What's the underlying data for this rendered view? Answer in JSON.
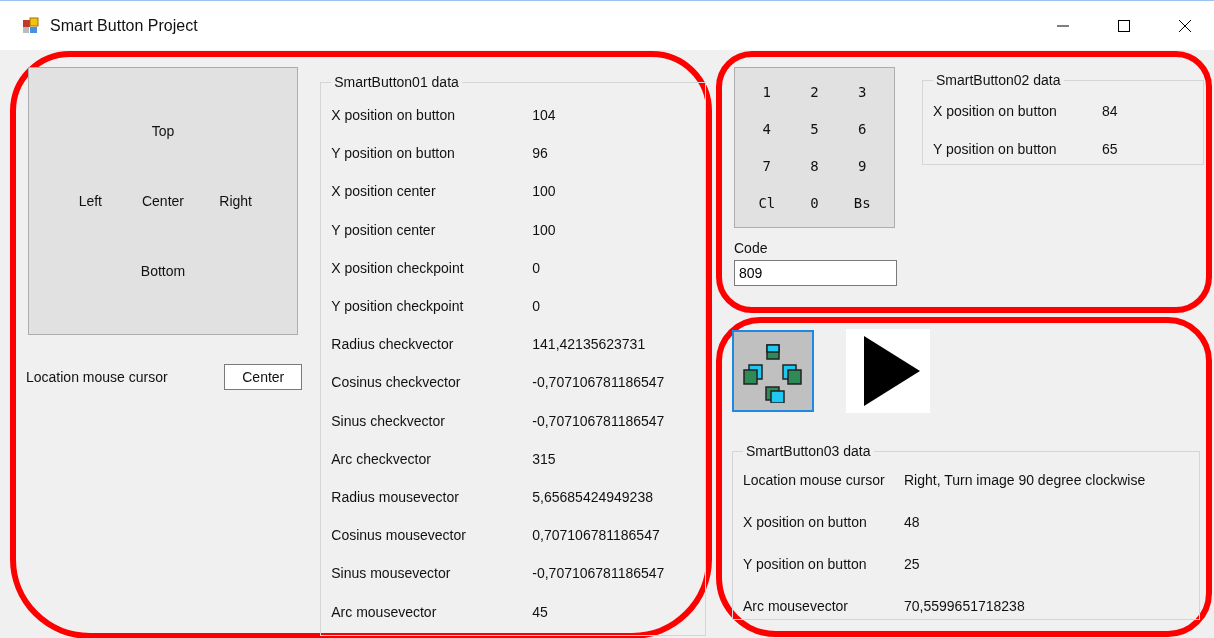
{
  "window": {
    "title": "Smart Button Project"
  },
  "smart_button_01": {
    "regions": [
      "Top",
      "Left",
      "Center",
      "Right",
      "Bottom"
    ],
    "location_label": "Location mouse cursor",
    "location_value": "Center"
  },
  "smart_button_01_data": {
    "title": "SmartButton01 data",
    "rows": [
      {
        "label": "X position on button",
        "value": "104"
      },
      {
        "label": "Y position on button",
        "value": "96"
      },
      {
        "label": "X position center",
        "value": "100"
      },
      {
        "label": "Y position center",
        "value": "100"
      },
      {
        "label": "X position checkpoint",
        "value": "0"
      },
      {
        "label": "Y position checkpoint",
        "value": "0"
      },
      {
        "label": "Radius checkvector",
        "value": "141,42135623731"
      },
      {
        "label": "Cosinus checkvector",
        "value": "-0,707106781186547"
      },
      {
        "label": "Sinus checkvector",
        "value": "-0,707106781186547"
      },
      {
        "label": "Arc checkvector",
        "value": "315"
      },
      {
        "label": "Radius mousevector",
        "value": "5,65685424949238"
      },
      {
        "label": "Cosinus mousevector",
        "value": "0,707106781186547"
      },
      {
        "label": "Sinus mousevector",
        "value": "-0,707106781186547"
      },
      {
        "label": "Arc mousevector",
        "value": "45"
      }
    ]
  },
  "keypad": {
    "keys": [
      "1",
      "2",
      "3",
      "4",
      "5",
      "6",
      "7",
      "8",
      "9",
      "Cl",
      "0",
      "Bs"
    ]
  },
  "code": {
    "label": "Code",
    "value": "809"
  },
  "smart_button_02_data": {
    "title": "SmartButton02 data",
    "rows": [
      {
        "label": "X position on button",
        "value": "84"
      },
      {
        "label": "Y position on button",
        "value": "65"
      }
    ]
  },
  "smart_button_03_data": {
    "title": "SmartButton03 data",
    "rows": [
      {
        "label": "Location mouse cursor",
        "value": "Right, Turn image 90 degree clockwise"
      },
      {
        "label": "X position on button",
        "value": "48"
      },
      {
        "label": "Y position on button",
        "value": "25"
      },
      {
        "label": "Arc mousevector",
        "value": "70,5599651718238"
      }
    ]
  }
}
